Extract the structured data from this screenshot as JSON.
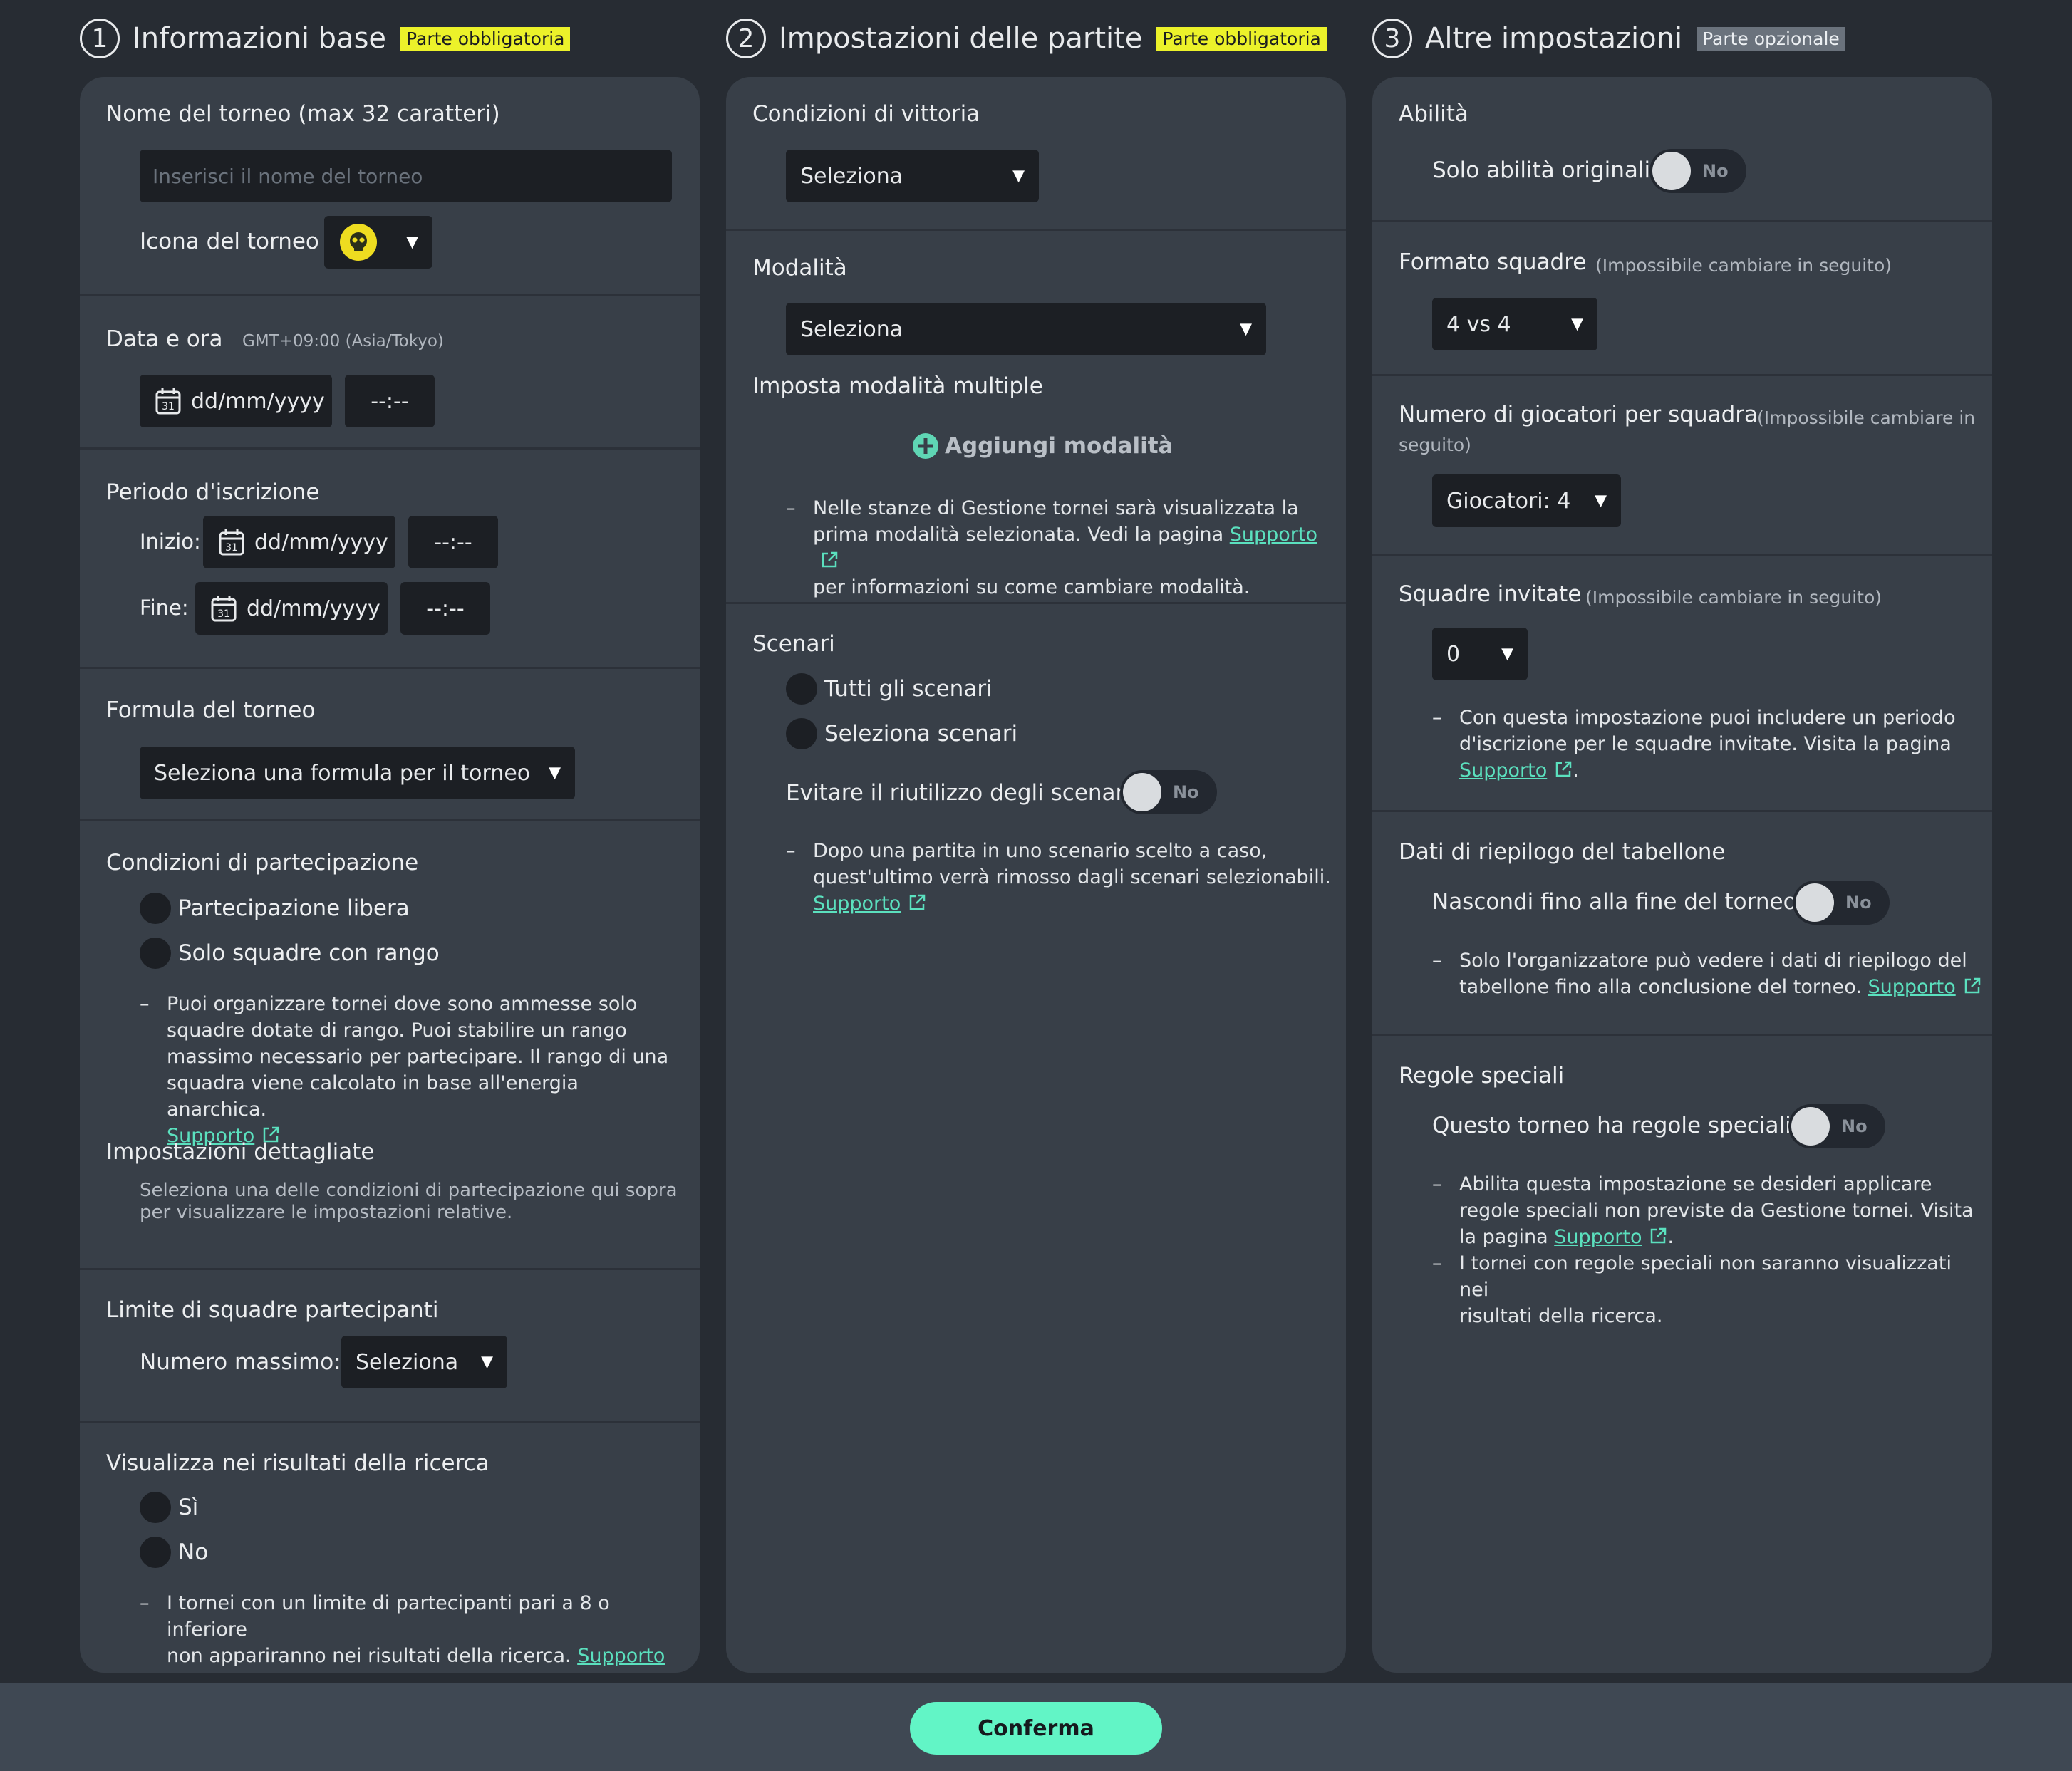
{
  "columns": {
    "basic": {
      "number": "1",
      "title": "Informazioni base",
      "badge": "Parte obbligatoria"
    },
    "match": {
      "number": "2",
      "title": "Impostazioni delle partite",
      "badge": "Parte obbligatoria"
    },
    "other": {
      "number": "3",
      "title": "Altre impostazioni",
      "badge": "Parte opzionale"
    }
  },
  "basic": {
    "name": {
      "label": "Nome del torneo (max 32 caratteri)",
      "placeholder": "Inserisci il nome del torneo"
    },
    "icon": {
      "label": "Icona del torneo"
    },
    "datetime": {
      "label": "Data e ora",
      "timezone": "GMT+09:00 (Asia/Tokyo)",
      "date": "dd/mm/yyyy",
      "time": "--:--"
    },
    "registration": {
      "label": "Periodo d'iscrizione",
      "start_label": "Inizio:",
      "end_label": "Fine:",
      "start_date": "dd/mm/yyyy",
      "start_time": "--:--",
      "end_date": "dd/mm/yyyy",
      "end_time": "--:--"
    },
    "formula": {
      "label": "Formula del torneo",
      "value": "Seleziona una formula per il torneo"
    },
    "participation": {
      "label": "Condizioni di partecipazione",
      "options": [
        "Partecipazione libera",
        "Solo squadre con rango"
      ],
      "note_lines": [
        "Puoi organizzare tornei dove sono ammesse solo",
        "squadre dotate di rango. Puoi stabilire un rango",
        "massimo necessario per partecipare. Il rango di una",
        "squadra viene calcolato in base all'energia anarchica."
      ],
      "support": "Supporto",
      "detail_label": "Impostazioni dettagliate",
      "detail_lines": [
        "Seleziona una delle condizioni di partecipazione qui sopra",
        "per visualizzare le impostazioni relative."
      ]
    },
    "limit": {
      "label": "Limite di squadre partecipanti",
      "max_label": "Numero massimo:",
      "value": "Seleziona"
    },
    "search": {
      "label": "Visualizza nei risultati della ricerca",
      "options": [
        "Sì",
        "No"
      ],
      "note_lines": [
        "I tornei con un limite di partecipanti pari a 8 o inferiore",
        "non appariranno nei risultati della ricerca."
      ],
      "support": "Supporto"
    }
  },
  "match": {
    "victory": {
      "label": "Condizioni di vittoria",
      "value": "Seleziona"
    },
    "mode": {
      "label": "Modalità",
      "value": "Seleziona",
      "multiple_label": "Imposta modalità multiple",
      "add_label": "Aggiungi modalità",
      "note_lines": [
        "Nelle stanze di Gestione tornei sarà visualizzata la",
        "prima modalità selezionata. Vedi la pagina",
        "per informazioni su come cambiare modalità."
      ],
      "support": "Supporto"
    },
    "scenarios": {
      "label": "Scenari",
      "options": [
        "Tutti gli scenari",
        "Seleziona scenari"
      ],
      "avoid_label": "Evitare il riutilizzo degli scenari",
      "toggle": "No",
      "note_lines": [
        "Dopo una partita in uno scenario scelto a caso,",
        "quest'ultimo verrà rimosso dagli scenari selezionabili."
      ],
      "support": "Supporto"
    }
  },
  "other": {
    "abilities": {
      "label": "Abilità",
      "option_label": "Solo abilità originali",
      "toggle": "No"
    },
    "format": {
      "label": "Formato squadre",
      "sub": "(Impossibile cambiare in seguito)",
      "value": "4 vs 4"
    },
    "players": {
      "label": "Numero di giocatori per squadra",
      "sub": "(Impossibile cambiare in",
      "sub2": "seguito)",
      "value": "Giocatori: 4"
    },
    "invited": {
      "label": "Squadre invitate",
      "sub": "(Impossibile cambiare in seguito)",
      "value": "0",
      "note_lines": [
        "Con questa impostazione puoi includere un periodo",
        "d'iscrizione per le squadre invitate. Visita la pagina"
      ],
      "support": "Supporto"
    },
    "summary": {
      "label": "Dati di riepilogo del tabellone",
      "option_label": "Nascondi fino alla fine del torneo",
      "toggle": "No",
      "note_lines": [
        "Solo l'organizzatore può vedere i dati di riepilogo del",
        "tabellone fino alla conclusione del torneo."
      ],
      "support": "Supporto"
    },
    "special": {
      "label": "Regole speciali",
      "option_label": "Questo torneo ha regole speciali",
      "toggle": "No",
      "note1_lines": [
        "Abilita questa impostazione se desideri applicare",
        "regole speciali non previste da Gestione tornei. Visita",
        "la pagina"
      ],
      "support": "Supporto",
      "note2_lines": [
        "I tornei con regole speciali non saranno visualizzati nei",
        "risultati della ricerca."
      ]
    }
  },
  "footer": {
    "confirm": "Conferma"
  },
  "colors": {
    "accent": "#62f5c6",
    "link": "#5be0be",
    "required_badge": "#ecf22a",
    "panel": "#383f48",
    "background": "#272c33"
  }
}
